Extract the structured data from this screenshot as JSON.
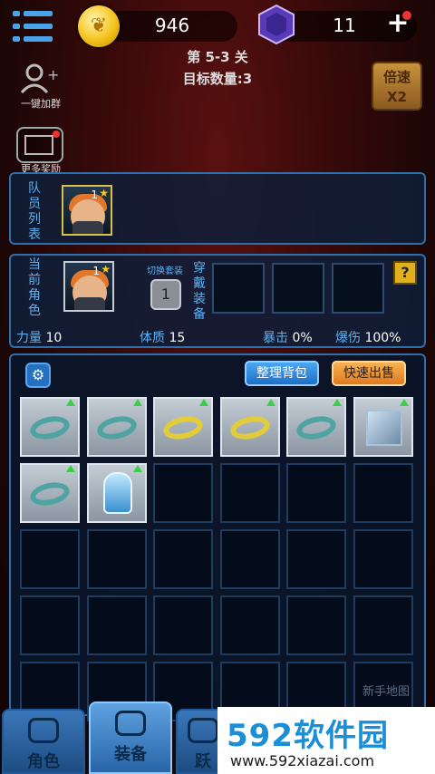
{
  "top_bar": {
    "gold_amount": "946",
    "gem_amount": "11",
    "add_label": "+"
  },
  "stage": {
    "level_text": "第 5-3 关",
    "target_text": "目标数量:3"
  },
  "speed_button": {
    "line1": "倍速",
    "line2": "X2"
  },
  "side_menu": [
    {
      "label": "一键加群",
      "icon": "add-group-icon"
    },
    {
      "label": "更多奖励",
      "icon": "video-reward-icon"
    }
  ],
  "team_panel": {
    "title": "队员列表",
    "heroes": [
      {
        "level": "1",
        "star": "★"
      }
    ]
  },
  "character_panel": {
    "title": "当前角色",
    "hero": {
      "level": "1",
      "star": "★"
    },
    "switch_label": "切换套装",
    "switch_count": "1",
    "equip_label": "穿戴装备",
    "help": "?"
  },
  "stats": [
    {
      "name": "力量",
      "value": "10"
    },
    {
      "name": "体质",
      "value": "15"
    },
    {
      "name": "暴击",
      "value": "0%"
    },
    {
      "name": "爆伤",
      "value": "100%"
    }
  ],
  "inventory": {
    "sort_label": "整理背包",
    "sell_label": "快速出售",
    "items": [
      {
        "type": "ring",
        "color": "teal",
        "upgrade": true
      },
      {
        "type": "ring",
        "color": "teal",
        "upgrade": true
      },
      {
        "type": "ring",
        "color": "gold",
        "upgrade": true
      },
      {
        "type": "ring",
        "color": "gold",
        "upgrade": true
      },
      {
        "type": "ring",
        "color": "teal",
        "upgrade": true
      },
      {
        "type": "box",
        "color": "ice",
        "upgrade": true
      },
      {
        "type": "ring",
        "color": "teal",
        "upgrade": true
      },
      {
        "type": "glove",
        "color": "blue",
        "upgrade": true
      }
    ],
    "newbie_text": "新手地图"
  },
  "bottom_nav": [
    {
      "label": "角色",
      "icon": "characters-icon",
      "active": false
    },
    {
      "label": "装备",
      "icon": "equipment-chest-icon",
      "active": true
    },
    {
      "label": "跃",
      "icon": "jump-icon",
      "active": false
    }
  ],
  "watermark": {
    "title": "592软件园",
    "url": "www.592xiazai.com"
  },
  "colors": {
    "accent": "#5fb0f0",
    "panel_border": "#2e6fae",
    "gold": "#f4c21c",
    "upgrade": "#3ad046"
  }
}
